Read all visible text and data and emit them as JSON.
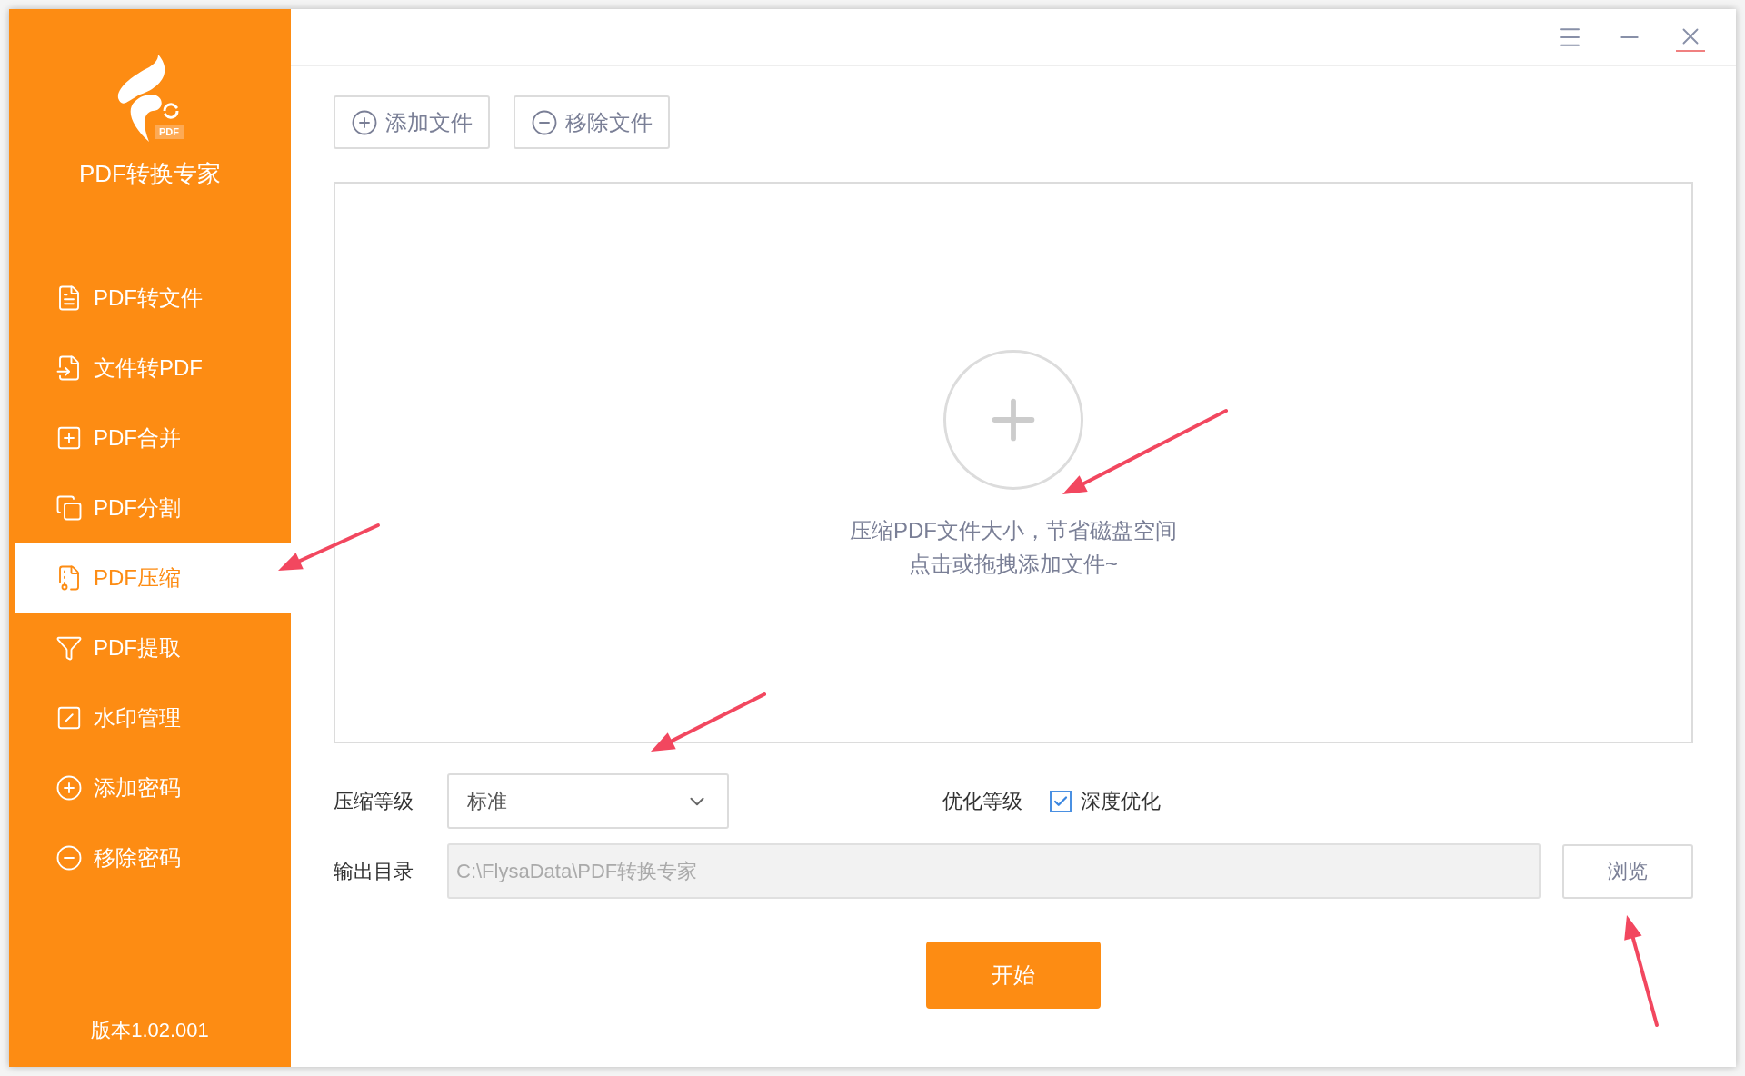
{
  "app": {
    "logo_badge": "PDF",
    "name": "PDF转换专家",
    "version": "版本1.02.001"
  },
  "sidebar": {
    "items": [
      {
        "label": "PDF转文件",
        "selected": false
      },
      {
        "label": "文件转PDF",
        "selected": false
      },
      {
        "label": "PDF合并",
        "selected": false
      },
      {
        "label": "PDF分割",
        "selected": false
      },
      {
        "label": "PDF压缩",
        "selected": true
      },
      {
        "label": "PDF提取",
        "selected": false
      },
      {
        "label": "水印管理",
        "selected": false
      },
      {
        "label": "添加密码",
        "selected": false
      },
      {
        "label": "移除密码",
        "selected": false
      }
    ]
  },
  "toolbar": {
    "buttons": [
      "添加文件",
      "移除文件"
    ]
  },
  "drop_zone": {
    "lines": [
      "压缩PDF文件大小，节省磁盘空间",
      "点击或拖拽添加文件~"
    ]
  },
  "options": {
    "compression_label": "压缩等级",
    "compression_value": "标准",
    "optimize_label": "优化等级",
    "deep_optimize": {
      "label": "深度优化",
      "checked": true
    },
    "output_label": "输出目录",
    "output_path": "C:\\FlysaData\\PDF转换专家",
    "browse": "浏览"
  },
  "start": "开始"
}
